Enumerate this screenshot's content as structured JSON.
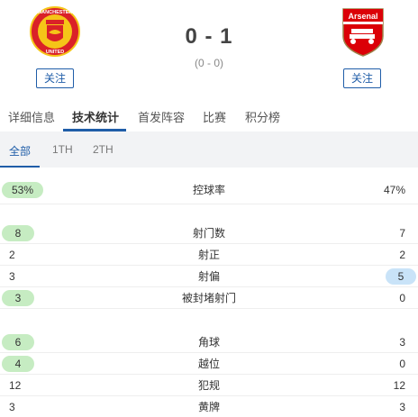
{
  "match": {
    "score": "0 - 1",
    "half_time": "(0 - 0)"
  },
  "home": {
    "logo_icon": "manchester-united-crest",
    "logo_text_top": "MANCHESTER",
    "logo_text_bottom": "UNITED",
    "follow_label": "关注"
  },
  "away": {
    "logo_icon": "arsenal-crest",
    "logo_text": "Arsenal",
    "follow_label": "关注"
  },
  "tabs": [
    "详细信息",
    "技术统计",
    "首发阵容",
    "比赛",
    "积分榜"
  ],
  "active_tab": "技术统计",
  "sub_tabs": [
    "全部",
    "1TH",
    "2TH"
  ],
  "active_sub_tab": "全部",
  "stats": [
    {
      "label": "控球率",
      "home": "53%",
      "away": "47%",
      "highlight": "home"
    },
    {
      "label": "射门数",
      "home": "8",
      "away": "7",
      "highlight": "home"
    },
    {
      "label": "射正",
      "home": "2",
      "away": "2",
      "highlight": "none"
    },
    {
      "label": "射偏",
      "home": "3",
      "away": "5",
      "highlight": "away"
    },
    {
      "label": "被封堵射门",
      "home": "3",
      "away": "0",
      "highlight": "home"
    },
    {
      "label": "角球",
      "home": "6",
      "away": "3",
      "highlight": "home"
    },
    {
      "label": "越位",
      "home": "4",
      "away": "0",
      "highlight": "home"
    },
    {
      "label": "犯规",
      "home": "12",
      "away": "12",
      "highlight": "none"
    },
    {
      "label": "黄牌",
      "home": "3",
      "away": "3",
      "highlight": "none"
    }
  ],
  "colors": {
    "accent": "#1f5da8",
    "home_highlight": "#c6ecc2",
    "away_highlight": "#c9e3f8",
    "man_utd_red": "#da2128",
    "arsenal_red": "#db0007"
  }
}
